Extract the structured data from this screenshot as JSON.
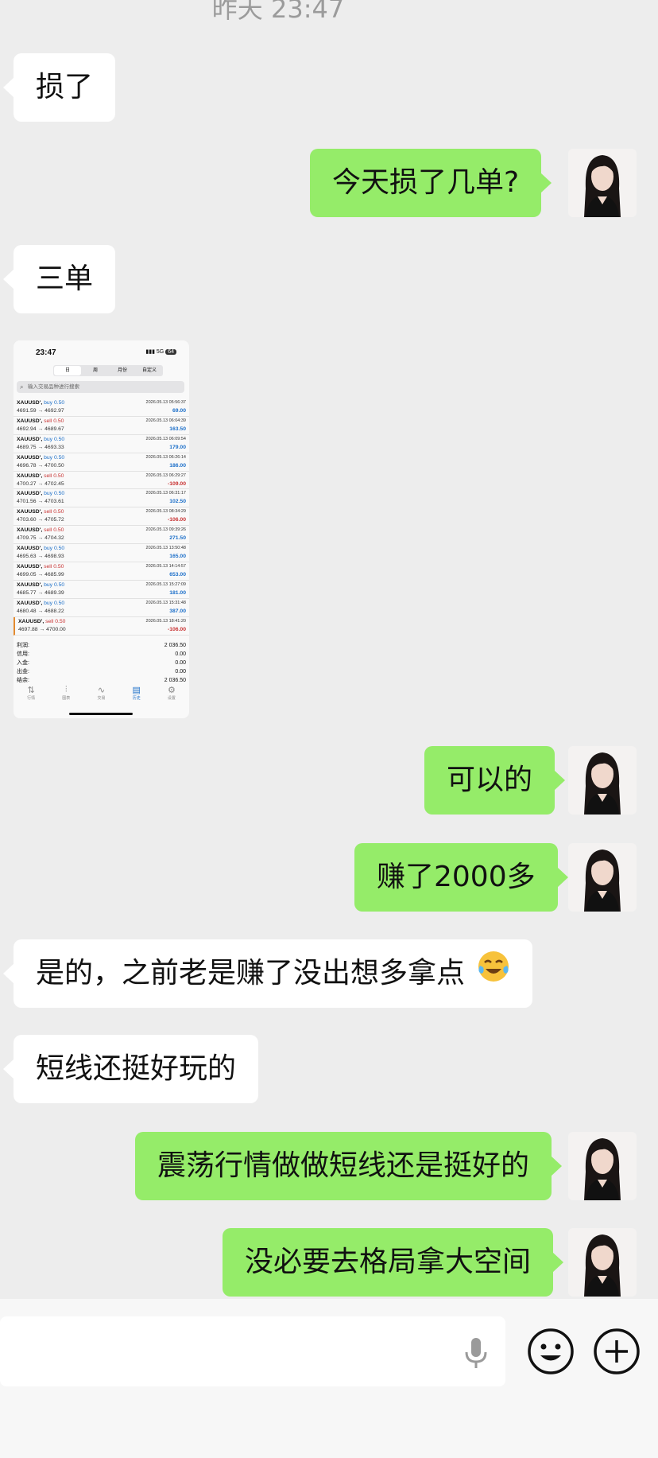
{
  "timestamp": "昨天 23:47",
  "messages": [
    {
      "text": "损了"
    },
    {
      "text": "今天损了几单?"
    },
    {
      "text": "三单"
    },
    {
      "text": "可以的"
    },
    {
      "text": "赚了2000多"
    },
    {
      "text": "是的，之前老是赚了没出想多拿点"
    },
    {
      "text": "短线还挺好玩的"
    },
    {
      "text": "震荡行情做做短线还是挺好的"
    },
    {
      "text": "没必要去格局拿大空间"
    }
  ],
  "screenshot": {
    "time": "23:47",
    "network": "5G",
    "battery": "64",
    "tabs": [
      "日",
      "周",
      "月份",
      "自定义"
    ],
    "search_placeholder": "输入交易品种进行搜索",
    "trades": [
      {
        "symbol": "XAUUSD'",
        "side": "buy 0.50",
        "type": "buy",
        "prices": "4691.59 → 4692.97",
        "datetime": "2026.05.13 05:56:37",
        "profit": "69.00"
      },
      {
        "symbol": "XAUUSD'",
        "side": "sell 0.50",
        "type": "sell",
        "prices": "4692.94 → 4689.67",
        "datetime": "2026.05.13 06:04:39",
        "profit": "163.50"
      },
      {
        "symbol": "XAUUSD'",
        "side": "buy 0.50",
        "type": "buy",
        "prices": "4689.75 → 4693.33",
        "datetime": "2026.05.13 06:09:54",
        "profit": "179.00"
      },
      {
        "symbol": "XAUUSD'",
        "side": "buy 0.50",
        "type": "buy",
        "prices": "4696.78 → 4700.50",
        "datetime": "2026.05.13 06:26:14",
        "profit": "186.00"
      },
      {
        "symbol": "XAUUSD'",
        "side": "sell 0.50",
        "type": "sell",
        "prices": "4700.27 → 4702.45",
        "datetime": "2026.05.13 06:29:27",
        "profit": "-109.00"
      },
      {
        "symbol": "XAUUSD'",
        "side": "buy 0.50",
        "type": "buy",
        "prices": "4701.56 → 4703.61",
        "datetime": "2026.05.13 06:31:17",
        "profit": "102.50"
      },
      {
        "symbol": "XAUUSD'",
        "side": "sell 0.50",
        "type": "sell",
        "prices": "4703.60 → 4705.72",
        "datetime": "2026.05.13 08:34:29",
        "profit": "-106.00"
      },
      {
        "symbol": "XAUUSD'",
        "side": "sell 0.50",
        "type": "sell",
        "prices": "4709.75 → 4704.32",
        "datetime": "2026.05.13 09:39:26",
        "profit": "271.50"
      },
      {
        "symbol": "XAUUSD'",
        "side": "buy 0.50",
        "type": "buy",
        "prices": "4695.63 → 4698.93",
        "datetime": "2026.05.13 13:50:48",
        "profit": "165.00"
      },
      {
        "symbol": "XAUUSD'",
        "side": "sell 0.50",
        "type": "sell",
        "prices": "4699.05 → 4685.99",
        "datetime": "2026.05.13 14:14:57",
        "profit": "653.00"
      },
      {
        "symbol": "XAUUSD'",
        "side": "buy 0.50",
        "type": "buy",
        "prices": "4685.77 → 4689.39",
        "datetime": "2026.05.13 15:27:09",
        "profit": "181.00"
      },
      {
        "symbol": "XAUUSD'",
        "side": "buy 0.50",
        "type": "buy",
        "prices": "4680.48 → 4688.22",
        "datetime": "2026.05.13 15:31:48",
        "profit": "387.00"
      },
      {
        "symbol": "XAUUSD'",
        "side": "sell 0.50",
        "type": "sell",
        "prices": "4697.88 → 4700.00",
        "datetime": "2026.05.13 18:41:20",
        "profit": "-106.00"
      }
    ],
    "summary": [
      {
        "label": "利润:",
        "value": "2 036.50"
      },
      {
        "label": "信用:",
        "value": "0.00"
      },
      {
        "label": "入金:",
        "value": "0.00"
      },
      {
        "label": "出金:",
        "value": "0.00"
      },
      {
        "label": "结余:",
        "value": "2 036.50"
      }
    ],
    "bottom_tabs": [
      "行情",
      "图表",
      "交易",
      "历史",
      "设置"
    ]
  },
  "colors": {
    "outgoing_bubble": "#95ec69",
    "incoming_bubble": "#ffffff",
    "background": "#ededed"
  },
  "icons": {
    "voice": "microphone-icon",
    "emoji": "smiley-face-icon",
    "more": "plus-circle-icon"
  }
}
